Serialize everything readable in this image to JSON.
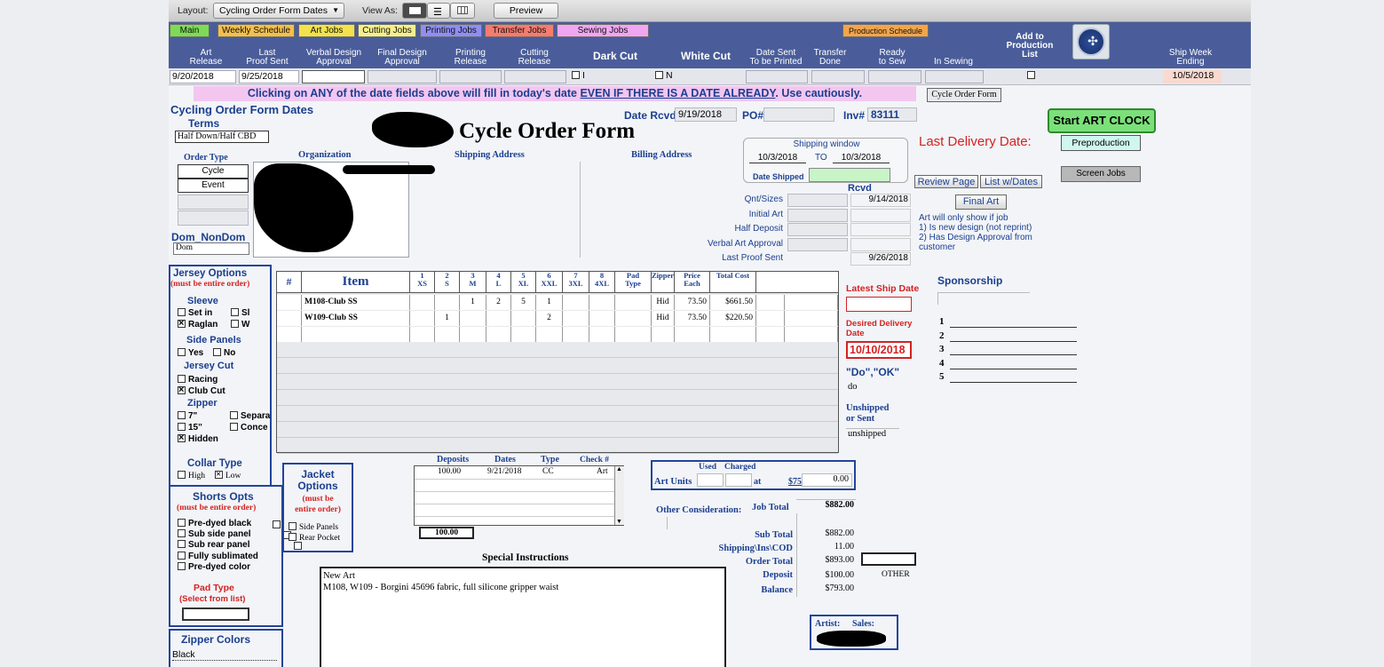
{
  "toolbar": {
    "layout_label": "Layout:",
    "layout_value": "Cycling Order Form Dates",
    "view_as_label": "View As:",
    "preview_label": "Preview"
  },
  "tabs": [
    {
      "label": "Main",
      "color": "#7ddc54"
    },
    {
      "label": "Weekly Schedule",
      "color": "#f5c04a"
    },
    {
      "label": "Art Jobs",
      "color": "#f3e24b"
    },
    {
      "label": "Cutting Jobs",
      "color": "#f5f08c"
    },
    {
      "label": "Printing Jobs",
      "color": "#8e8ef6"
    },
    {
      "label": "Transfer Jobs",
      "color": "#f77b6e"
    },
    {
      "label": "Sewing Jobs",
      "color": "#f1a6f1"
    },
    {
      "label": "Production Schedule",
      "color": "#f3a54b"
    }
  ],
  "headers": {
    "art_release": "Art\nRelease",
    "last_proof_sent": "Last\nProof Sent",
    "verbal_design_approval": "Verbal Design\nApproval",
    "final_design_approval": "Final Design\nApproval",
    "printing_release": "Printing\nRelease",
    "cutting_release": "Cutting\nRelease",
    "dark_cut": "Dark Cut",
    "white_cut": "White Cut",
    "date_sent_to_be_printed": "Date Sent\nTo be Printed",
    "transfer_done": "Transfer\nDone",
    "ready_to_sew": "Ready\nto Sew",
    "in_sewing": "In Sewing",
    "add_to_production_list": "Add to\nProduction\nList",
    "ship_week_ending": "Ship Week\nEnding"
  },
  "date_values": {
    "art_release": "9/20/2018",
    "last_proof_sent": "9/25/2018",
    "dark_cut_flag": "I",
    "white_cut_flag": "N",
    "ship_week_ending": "10/5/2018"
  },
  "notice": {
    "part1": "Clicking on ANY of the date fields above will fill in today's date ",
    "part2": "EVEN IF THERE IS A DATE ALREADY",
    "part3": ".  Use cautiously."
  },
  "form": {
    "section_title": "Cycling Order Form Dates",
    "cycle_form_button": "Cycle Order Form",
    "title": "Cycle Order Form",
    "date_rcvd_label": "Date Rcvd",
    "date_rcvd": "9/19/2018",
    "po_label": "PO#",
    "inv_label": "Inv#",
    "inv_value": "83111",
    "start_art_clock": "Start ART CLOCK",
    "last_delivery_label": "Last Delivery Date:",
    "preproduction": "Preproduction",
    "screen_jobs": "Screen Jobs",
    "terms_label": "Terms",
    "terms_value": "Half Down/Half CBD",
    "order_type_label": "Order Type",
    "order_type_options": [
      "Cycle",
      "Event"
    ],
    "organization_label": "Organization",
    "shipping_address_label": "Shipping Address",
    "billing_address_label": "Billing Address",
    "dom_label": "Dom_NonDom",
    "dom_value": "Dom"
  },
  "shipping_window": {
    "label": "Shipping window",
    "from": "10/3/2018",
    "to_label": "TO",
    "to": "10/3/2018",
    "date_shipped_label": "Date Shipped"
  },
  "review": {
    "review_page": "Review Page",
    "list_w_dates": "List w/Dates",
    "rcvd_label": "Rcvd",
    "final_art": "Final Art",
    "rows": [
      {
        "label": "Qnt/Sizes",
        "value": "9/14/2018"
      },
      {
        "label": "Initial Art",
        "value": ""
      },
      {
        "label": "Half Deposit",
        "value": ""
      },
      {
        "label": "Verbal Art Approval",
        "value": ""
      },
      {
        "label": "Last Proof Sent",
        "value": "9/26/2018"
      }
    ],
    "note": "Art will only show if job\n1) Is new design (not reprint)\n2) Has Design Approval from customer"
  },
  "jersey": {
    "title": "Jersey Options",
    "subtitle": "(must be entire order)",
    "sleeve_label": "Sleeve",
    "set_in": "Set in",
    "sl": "Sl",
    "raglan": "Raglan",
    "w": "W",
    "side_panels_label": "Side Panels",
    "yes": "Yes",
    "no": "No",
    "cut_label": "Jersey Cut",
    "racing": "Racing",
    "club_cut": "Club Cut",
    "zipper_label": "Zipper",
    "z7": "7\"",
    "z15": "15\"",
    "hidden": "Hidden",
    "separ": "Separa",
    "conce": "Conce",
    "collar_label": "Collar Type",
    "high": "High",
    "low": "Low"
  },
  "shorts": {
    "title": "Shorts Opts",
    "subtitle": "(must be entire order)",
    "options": [
      "Pre-dyed black",
      "Sub side panel",
      "Sub rear panel",
      "Fully sublimated",
      "Pre-dyed color"
    ],
    "pad_type_label": "Pad Type",
    "pad_type_sub": "(Select from list)",
    "zipper_colors_label": "Zipper Colors",
    "zipper_color_value": "Black"
  },
  "jacket": {
    "title": "Jacket\nOptions",
    "subtitle": "(must be\nentire order)",
    "side_panels": "Side Panels",
    "rear_pocket": "Rear Pocket"
  },
  "items_table": {
    "headers": [
      "#",
      "Item",
      "1\nXS",
      "2\nS",
      "3\nM",
      "4\nL",
      "5\nXL",
      "6\nXXL",
      "7\n3XL",
      "8\n4XL",
      "Pad\nType",
      "Zipper",
      "Price\nEach",
      "Total Cost"
    ],
    "rows": [
      [
        "",
        "M108-Club SS",
        "",
        "",
        "1",
        "2",
        "5",
        "1",
        "",
        "",
        "",
        "Hid",
        "73.50",
        "$661.50"
      ],
      [
        "",
        "W109-Club SS",
        "",
        "1",
        "",
        "",
        "",
        "2",
        "",
        "",
        "",
        "Hid",
        "73.50",
        "$220.50"
      ]
    ]
  },
  "ship_side": {
    "latest_ship_label": "Latest Ship Date",
    "desired_delivery_label": "Desired Delivery\nDate",
    "desired_delivery": "10/10/2018",
    "do_ok_label": "\"Do\",\"OK\"",
    "do_value": "do",
    "unshipped_label": "Unshipped\nor Sent",
    "unshipped_value": "unshipped",
    "sponsorship_label": "Sponsorship",
    "sponsor_numbers": [
      "1",
      "2",
      "3",
      "4",
      "5"
    ]
  },
  "deposits": {
    "headers": [
      "Deposits",
      "Dates",
      "Type",
      "Check #"
    ],
    "row": [
      "100.00",
      "9/21/2018",
      "CC",
      "Art"
    ],
    "total": "100.00"
  },
  "art_units": {
    "label": "Art Units",
    "used": "Used",
    "charged": "Charged",
    "at": "at",
    "rate": "$75",
    "value": "0.00"
  },
  "totals": {
    "other_consideration": "Other Consideration:",
    "job_total_label": "Job Total",
    "job_total": "$882.00",
    "subtotal_label": "Sub Total",
    "subtotal": "$882.00",
    "shipping_label": "Shipping\\Ins\\COD",
    "shipping": "11.00",
    "order_total_label": "Order Total",
    "order_total": "$893.00",
    "deposit_label": "Deposit",
    "deposit": "$100.00",
    "balance_label": "Balance",
    "balance": "$793.00",
    "other": "OTHER"
  },
  "special": {
    "label": "Special Instructions",
    "line1": "New Art",
    "line2": "M108, W109 - Borgini 45696 fabric, full silicone gripper waist"
  },
  "artist": {
    "label": "Artist:",
    "sales": "Sales:"
  }
}
